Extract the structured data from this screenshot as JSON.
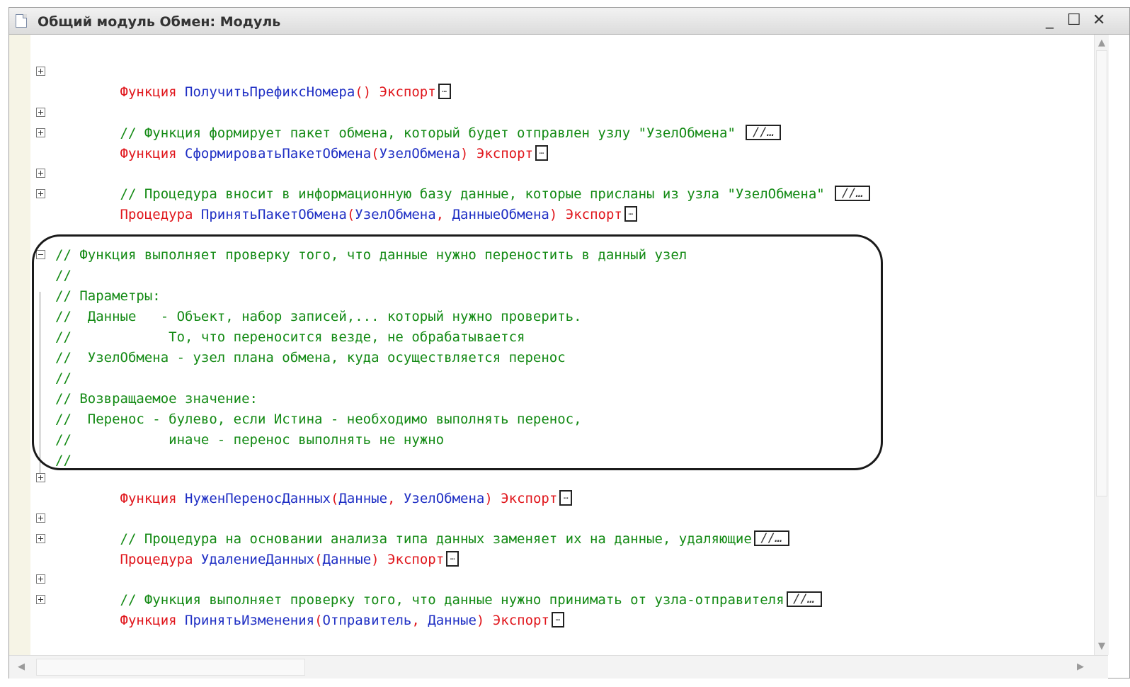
{
  "window": {
    "title": "Общий модуль Обмен: Модуль",
    "minimize": "_",
    "maximize": "☐",
    "close": "✕"
  },
  "fold_marker": "…",
  "comment_marker": "//…",
  "code": {
    "l1": {
      "kw": "Функция",
      "name": "ПолучитьПрефиксНомера",
      "params": "()",
      "export": "Экспорт"
    },
    "l2": {
      "comment": "// Функция формирует пакет обмена, который будет отправлен узлу \"УзелОбмена\""
    },
    "l3": {
      "kw": "Функция",
      "name": "СформироватьПакетОбмена",
      "open": "(",
      "p1": "УзелОбмена",
      "close": ")",
      "export": "Экспорт"
    },
    "l4": {
      "comment": "// Процедура вносит в информационную базу данные, которые присланы из узла \"УзелОбмена\""
    },
    "l5": {
      "kw": "Процедура",
      "name": "ПринятьПакетОбмена",
      "open": "(",
      "p1": "УзелОбмена",
      "sep": ", ",
      "p2": "ДанныеОбмена",
      "close": ")",
      "export": "Экспорт"
    },
    "block": [
      "// Функция выполняет проверку того, что данные нужно переностить в данный узел",
      "//",
      "// Параметры:",
      "//  Данные   - Объект, набор записей,... который нужно проверить.",
      "//            То, что переносится везде, не обрабатывается",
      "//  УзелОбмена - узел плана обмена, куда осуществляется перенос",
      "//",
      "// Возвращаемое значение:",
      "//  Перенос - булево, если Истина - необходимо выполнять перенос,",
      "//            иначе - перенос выполнять не нужно",
      "//"
    ],
    "l6": {
      "kw": "Функция",
      "name": "НуженПереносДанных",
      "open": "(",
      "p1": "Данные",
      "sep": ", ",
      "p2": "УзелОбмена",
      "close": ")",
      "export": "Экспорт"
    },
    "l7": {
      "comment": "// Процедура на основании анализа типа данных заменяет их на данные, удаляющие"
    },
    "l8": {
      "kw": "Процедура",
      "name": "УдалениеДанных",
      "open": "(",
      "p1": "Данные",
      "close": ")",
      "export": "Экспорт"
    },
    "l9": {
      "comment": "// Функция выполняет проверку того, что данные нужно принимать от узла-отправителя"
    },
    "l10": {
      "kw": "Функция",
      "name": "ПринятьИзменения",
      "open": "(",
      "p1": "Отправитель",
      "sep": ", ",
      "p2": "Данные",
      "close": ")",
      "export": "Экспорт"
    }
  },
  "colors": {
    "keyword": "#e0151b",
    "identifier": "#1f2fc4",
    "comment": "#138a14",
    "gutter": "#f6f4e6"
  }
}
